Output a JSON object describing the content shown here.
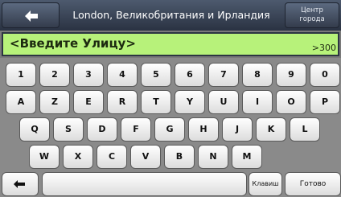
{
  "header": {
    "title": "London, Великобритания и Ирландия",
    "back_icon": "left-arrow-icon",
    "city_center_line1": "Центр",
    "city_center_line2": "города"
  },
  "search": {
    "value": "<Введите Улицу>",
    "count": ">300"
  },
  "keyboard": {
    "rows": [
      [
        "1",
        "2",
        "3",
        "4",
        "5",
        "6",
        "7",
        "8",
        "9",
        "0"
      ],
      [
        "A",
        "Z",
        "E",
        "R",
        "T",
        "Y",
        "U",
        "I",
        "O",
        "P"
      ],
      [
        "Q",
        "S",
        "D",
        "F",
        "G",
        "H",
        "J",
        "K",
        "L"
      ],
      [
        "W",
        "X",
        "C",
        "V",
        "B",
        "N",
        "M"
      ]
    ],
    "backspace_icon": "backspace-arrow-icon",
    "layout_label": "Клавиш",
    "done_label": "Готово"
  }
}
